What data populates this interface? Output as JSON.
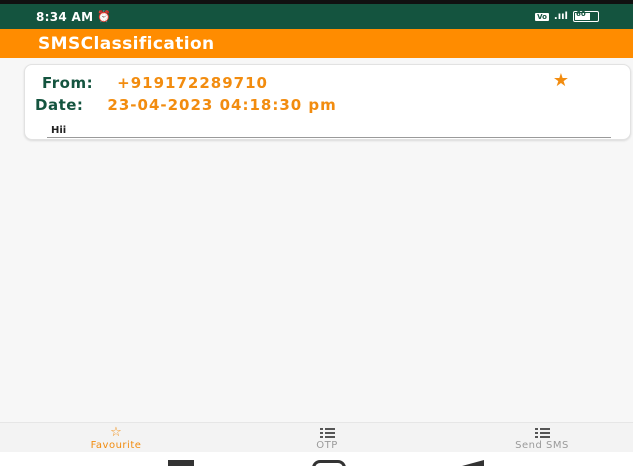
{
  "status_bar": {
    "time": "8:34 AM",
    "alarm_icon": "alarm-icon",
    "network_label": "Vo",
    "signal": ".ııl",
    "battery_level": "60"
  },
  "app_bar": {
    "title": "SMSClassification"
  },
  "messages": [
    {
      "from_label": "From:",
      "from_value": "+919172289710",
      "date_label": "Date:",
      "date_value": "23-04-2023 04:18:30 pm",
      "body": "Hii",
      "starred": true
    }
  ],
  "bottom_nav": {
    "items": [
      {
        "label": "Favourite",
        "icon": "star-outline-icon",
        "active": true
      },
      {
        "label": "OTP",
        "icon": "list-icon",
        "active": false
      },
      {
        "label": "Send SMS",
        "icon": "list-icon",
        "active": false
      }
    ]
  },
  "colors": {
    "status_bar": "#14543f",
    "app_bar": "#ff8c00",
    "accent": "#f28c0f",
    "label": "#14543f"
  }
}
